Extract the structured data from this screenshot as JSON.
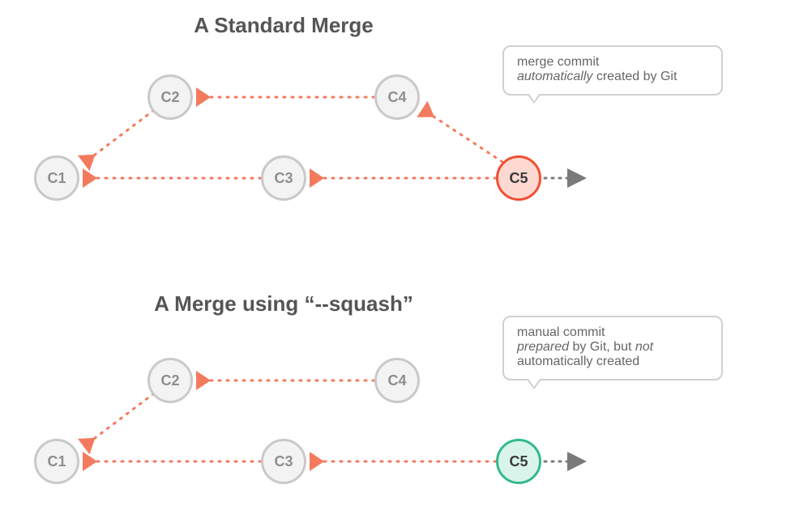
{
  "diagram1": {
    "title": "A Standard Merge",
    "commits": {
      "c1": "C1",
      "c2": "C2",
      "c3": "C3",
      "c4": "C4",
      "c5": "C5"
    },
    "callout": {
      "line1": "merge commit",
      "line2_prefix": "",
      "line2_em": "automatically",
      "line2_suffix": " created by Git"
    }
  },
  "diagram2": {
    "title": "A Merge using “--squash”",
    "commits": {
      "c1": "C1",
      "c2": "C2",
      "c3": "C3",
      "c4": "C4",
      "c5": "C5"
    },
    "callout": {
      "line1": "manual commit",
      "line2_em1": "prepared",
      "line2_mid": " by Git, but ",
      "line2_em2": "not",
      "line3": "automatically created"
    }
  },
  "colors": {
    "dotted": "#f47a5e",
    "node_border": "#c9c9c9",
    "node_fill": "#f3f3f3",
    "red": "#f24e34",
    "green": "#33b98f",
    "grey_arrow": "#7a7a7a"
  }
}
